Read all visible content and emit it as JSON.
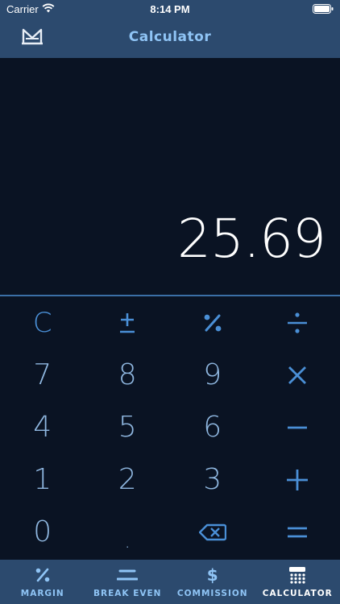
{
  "status_bar": {
    "carrier": "Carrier",
    "time": "8:14 PM"
  },
  "nav": {
    "title": "Calculator",
    "logo_icon": "m-logo-icon"
  },
  "display": {
    "value": "25.69"
  },
  "keypad": {
    "clear": "C",
    "digits": {
      "seven": "7",
      "eight": "8",
      "nine": "9",
      "four": "4",
      "five": "5",
      "six": "6",
      "one": "1",
      "two": "2",
      "three": "3",
      "zero": "0",
      "dot": "."
    },
    "icons": [
      "plus-minus-icon",
      "percent-icon",
      "divide-icon",
      "multiply-icon",
      "minus-icon",
      "plus-icon",
      "backspace-icon",
      "equals-icon"
    ]
  },
  "tabs": [
    {
      "label": "MARGIN",
      "icon": "percent-icon"
    },
    {
      "label": "BREAK EVEN",
      "icon": "break-even-icon"
    },
    {
      "label": "COMMISSION",
      "icon": "dollar-icon"
    },
    {
      "label": "CALCULATOR",
      "icon": "calculator-icon",
      "active": true
    }
  ],
  "colors": {
    "bar": "#2c4a6e",
    "background": "#0a1323",
    "accent": "#4a8fd6",
    "digit": "#8fb7e0",
    "title": "#8fc4f5"
  }
}
